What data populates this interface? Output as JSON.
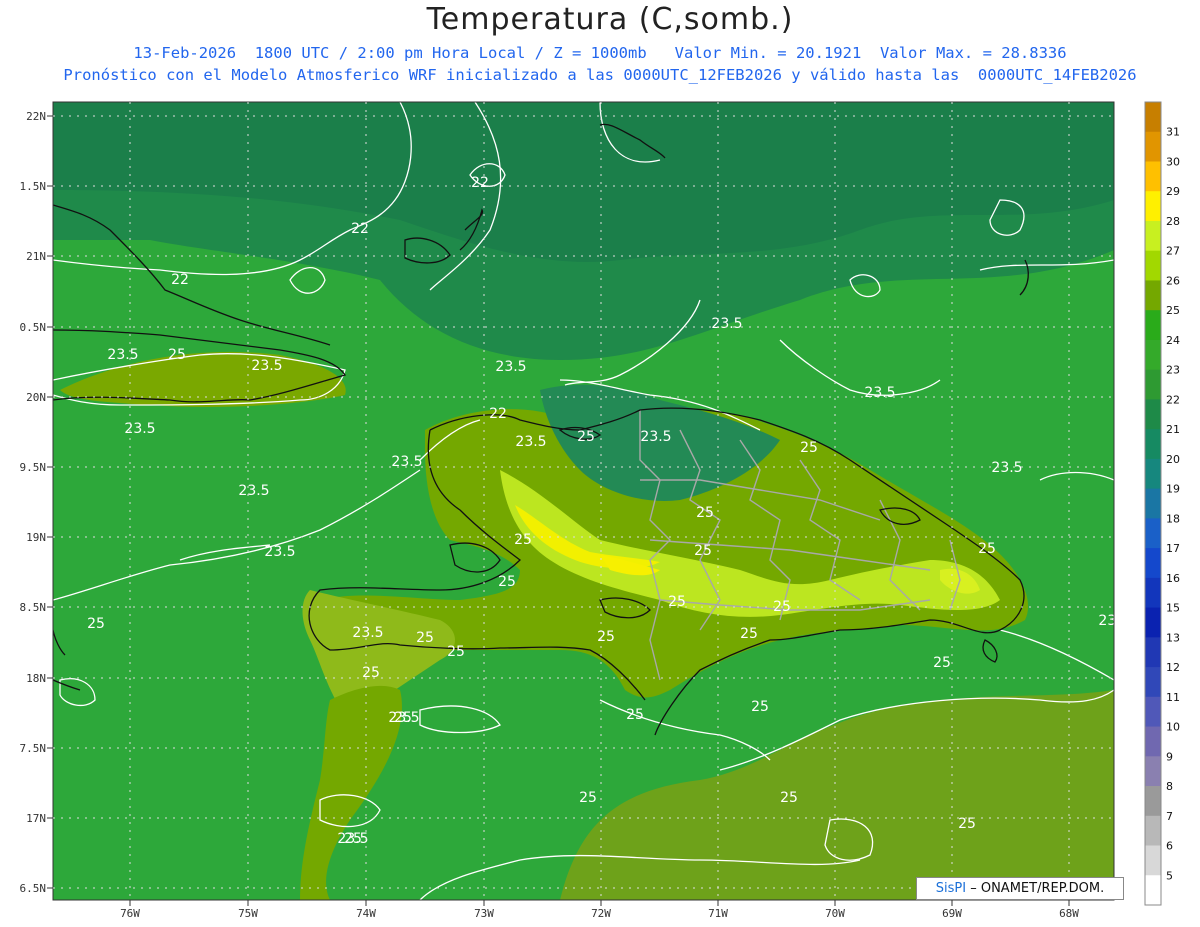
{
  "title": "Temperatura (C,somb.)",
  "subtitle1": "13-Feb-2026  1800 UTC / 2:00 pm Hora Local / Z = 1000mb   Valor Min. = 20.1921  Valor Max. = 28.8336",
  "subtitle2": "Pronóstico con el Modelo Atmosferico WRF inicializado a las 0000UTC_12FEB2026 y válido hasta las  0000UTC_14FEB2026",
  "credit": {
    "brand": "SisPI",
    "rest": " – ONAMET/REP.DOM."
  },
  "lat_labels": [
    "22N",
    "1.5N",
    "21N",
    "0.5N",
    "20N",
    "9.5N",
    "19N",
    "8.5N",
    "18N",
    "7.5N",
    "17N",
    "6.5N"
  ],
  "lon_labels": [
    "76W",
    "75W",
    "74W",
    "73W",
    "72W",
    "71W",
    "70W",
    "69W",
    "68W"
  ],
  "contour_labels": [
    "22",
    "22",
    "22",
    "23.5",
    "23.5",
    "25",
    "23.5",
    "23.5",
    "23.5",
    "23.5",
    "23.5",
    "23.5",
    "23.5",
    "25",
    "23.5",
    "22",
    "23.5",
    "25",
    "23.5",
    "25",
    "25",
    "25",
    "25",
    "25",
    "25",
    "25",
    "25",
    "25",
    "25",
    "25",
    "25",
    "25",
    "25",
    "25",
    "23.5",
    "25",
    "23.5",
    "25",
    "23.5",
    "25",
    "25",
    "25",
    "23.5",
    "25"
  ],
  "colorbar": {
    "labels": [
      "31",
      "30",
      "29",
      "28",
      "27",
      "26",
      "25",
      "24",
      "23",
      "22",
      "21",
      "20",
      "19",
      "18",
      "17",
      "16",
      "15",
      "13",
      "12",
      "11",
      "10",
      "9",
      "8",
      "7",
      "6",
      "5"
    ],
    "colors": [
      "#c77f00",
      "#e19500",
      "#ffc000",
      "#fff000",
      "#c8f020",
      "#a2d800",
      "#74a800",
      "#2aab1a",
      "#34aa2a",
      "#2e9a32",
      "#1e8a48",
      "#168a62",
      "#16877e",
      "#1a76a4",
      "#1a60c8",
      "#1448cc",
      "#1236bc",
      "#0a22b0",
      "#2038b4",
      "#3048b8",
      "#5058b8",
      "#7068b0",
      "#8a80b0",
      "#9a9a9a",
      "#b8b8b8",
      "#d8d8d8",
      "#ffffff"
    ]
  },
  "colors": {
    "ocean": "#2d9b3c",
    "ocean_dark": "#1f8050",
    "land_mid": "#73a800",
    "land_hot": "#c8ee20",
    "hot_spot": "#f5f000"
  }
}
